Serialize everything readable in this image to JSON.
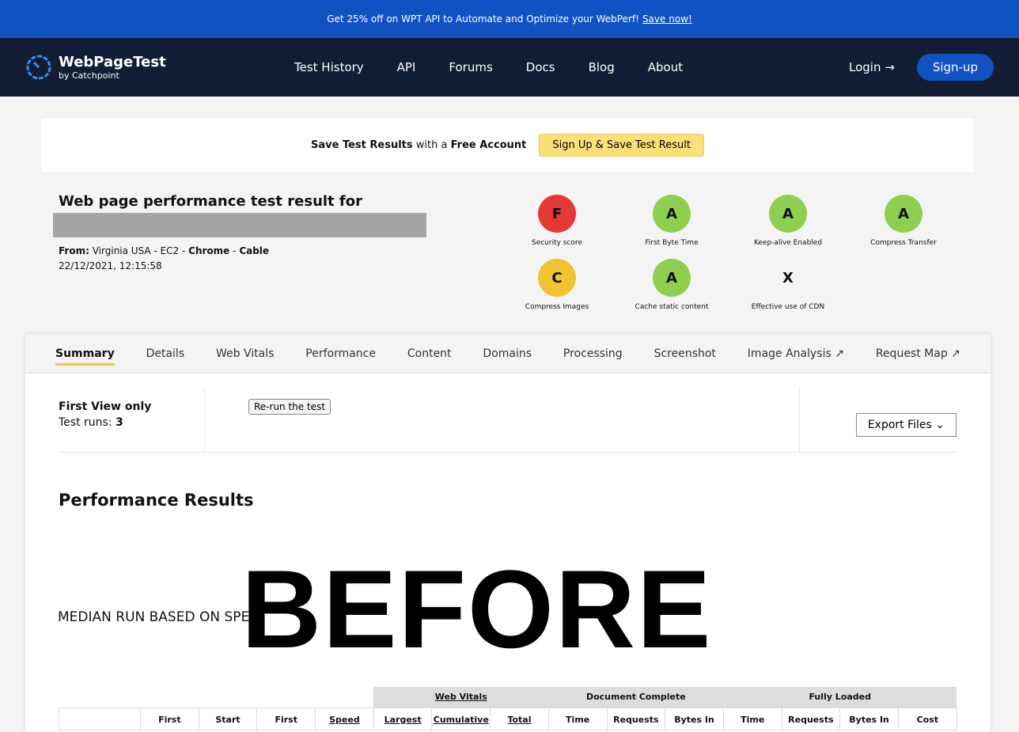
{
  "promo": {
    "text": "Get 25% off on WPT API to Automate and Optimize your WebPerf!",
    "link": "Save now!"
  },
  "nav": {
    "brand": "WebPageTest",
    "sub": "by Catchpoint",
    "links": [
      "Test History",
      "API",
      "Forums",
      "Docs",
      "Blog",
      "About"
    ],
    "login": "Login →",
    "signup": "Sign-up"
  },
  "save": {
    "b1": "Save Test Results",
    "m": "with a",
    "b2": "Free Account",
    "button": "Sign Up & Save Test Result"
  },
  "test": {
    "title": "Web page performance test result for",
    "from_label": "From:",
    "from": "Virginia USA - EC2 -",
    "browser": "Chrome",
    "sep": "-",
    "conn": "Cable",
    "date": "22/12/2021, 12:15:58"
  },
  "grades": [
    {
      "grade": "F",
      "label": "Security score",
      "color": "#e53935"
    },
    {
      "grade": "A",
      "label": "First Byte Time",
      "color": "#8fcf50"
    },
    {
      "grade": "A",
      "label": "Keep-alive Enabled",
      "color": "#8fcf50"
    },
    {
      "grade": "A",
      "label": "Compress Transfer",
      "color": "#8fcf50"
    },
    {
      "grade": "C",
      "label": "Compress Images",
      "color": "#f1c232"
    },
    {
      "grade": "A",
      "label": "Cache static content",
      "color": "#8fcf50"
    },
    {
      "grade": "X",
      "label": "Effective use of CDN",
      "color": ""
    }
  ],
  "tabs": [
    "Summary",
    "Details",
    "Web Vitals",
    "Performance",
    "Content",
    "Domains",
    "Processing",
    "Screenshot",
    "Image Analysis ↗",
    "Request Map ↗"
  ],
  "summary": {
    "view": "First View only",
    "runs_label": "Test runs:",
    "runs": "3",
    "rerun": "Re-run the test",
    "export": "Export Files ⌄"
  },
  "results": {
    "heading": "Performance Results",
    "median": "MEDIAN RUN BASED ON SPE",
    "groups": [
      "Web Vitals",
      "Document Complete",
      "Fully Loaded"
    ],
    "columns": [
      "",
      "First",
      "Start",
      "First",
      "Speed",
      "Largest",
      "Cumulative",
      "Total",
      "Time",
      "Requests",
      "Bytes In",
      "Time",
      "Requests",
      "Bytes In",
      "Cost"
    ]
  },
  "overlay": "BEFORE"
}
